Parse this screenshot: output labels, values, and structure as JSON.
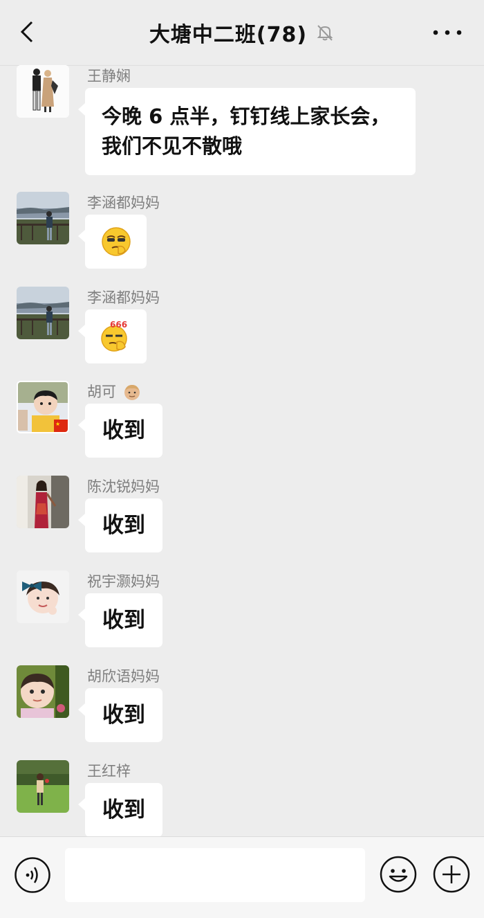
{
  "header": {
    "title": "大塘中二班(78)",
    "back_icon": "chevron-left-icon",
    "mute_icon": "bell-off-icon",
    "more_icon": "more-dots-icon"
  },
  "messages": [
    {
      "sender": "王静娴",
      "type": "text",
      "lines": [
        "今晚 6 点半，钉钉线上家长会，",
        "我们不见不散哦"
      ],
      "avatar": "avatar-wedding-couple"
    },
    {
      "sender": "李涵都妈妈",
      "type": "sticker",
      "sticker": "cool-emoji-sticker",
      "avatar": "avatar-lakeside"
    },
    {
      "sender": "李涵都妈妈",
      "type": "sticker",
      "sticker": "666-emoji-sticker",
      "sticker_text": "666",
      "avatar": "avatar-lakeside"
    },
    {
      "sender": "胡可",
      "sender_emoji": "man-emoji",
      "type": "text",
      "text": "收到",
      "avatar": "avatar-boy-flag"
    },
    {
      "sender": "陈沈锐妈妈",
      "type": "text",
      "text": "收到",
      "avatar": "avatar-woman-dress"
    },
    {
      "sender": "祝宇灏妈妈",
      "type": "text",
      "text": "收到",
      "avatar": "avatar-little-girl-bow"
    },
    {
      "sender": "胡欣语妈妈",
      "type": "text",
      "text": "收到",
      "avatar": "avatar-baby"
    },
    {
      "sender": "王红梓",
      "type": "text",
      "text": "收到",
      "avatar": "avatar-girl-garden"
    }
  ],
  "input_bar": {
    "voice_icon": "voice-icon",
    "emoji_icon": "smiley-icon",
    "plus_icon": "plus-circle-icon",
    "input_value": ""
  },
  "colors": {
    "background": "#ededed",
    "bubble": "#ffffff",
    "name_text": "#7f7f7f"
  }
}
